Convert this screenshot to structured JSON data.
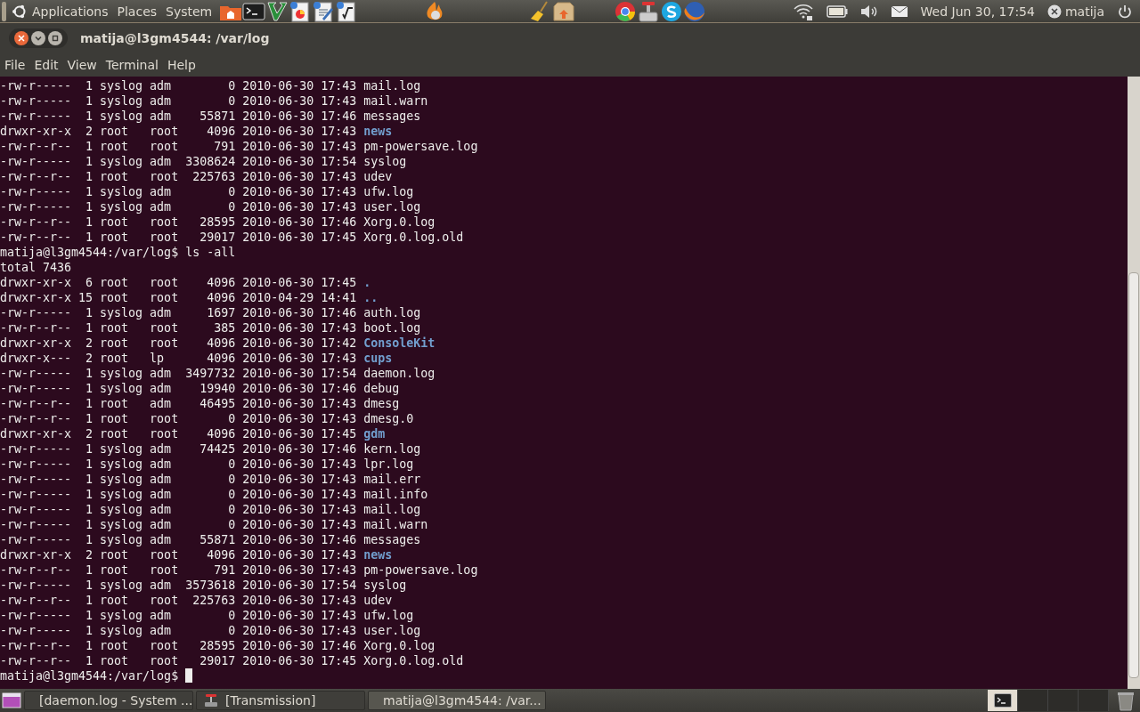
{
  "top_panel": {
    "menus": [
      {
        "label": "Applications"
      },
      {
        "label": "Places"
      },
      {
        "label": "System"
      }
    ],
    "clock": "Wed Jun 30, 17:54",
    "user": "matija"
  },
  "window": {
    "title": "matija@l3gm4544: /var/log",
    "menu": [
      {
        "label": "File"
      },
      {
        "label": "Edit"
      },
      {
        "label": "View"
      },
      {
        "label": "Terminal"
      },
      {
        "label": "Help"
      }
    ]
  },
  "terminal": {
    "lines": [
      {
        "kind": "entry",
        "info": "-rw-r-----  1 syslog adm        0 2010-06-30 17:43",
        "name": "mail.log",
        "directory": false
      },
      {
        "kind": "entry",
        "info": "-rw-r-----  1 syslog adm        0 2010-06-30 17:43",
        "name": "mail.warn",
        "directory": false
      },
      {
        "kind": "entry",
        "info": "-rw-r-----  1 syslog adm    55871 2010-06-30 17:46",
        "name": "messages",
        "directory": false
      },
      {
        "kind": "entry",
        "info": "drwxr-xr-x  2 root   root    4096 2010-06-30 17:43",
        "name": "news",
        "directory": true
      },
      {
        "kind": "entry",
        "info": "-rw-r--r--  1 root   root     791 2010-06-30 17:43",
        "name": "pm-powersave.log",
        "directory": false
      },
      {
        "kind": "entry",
        "info": "-rw-r-----  1 syslog adm  3308624 2010-06-30 17:54",
        "name": "syslog",
        "directory": false
      },
      {
        "kind": "entry",
        "info": "-rw-r--r--  1 root   root  225763 2010-06-30 17:43",
        "name": "udev",
        "directory": false
      },
      {
        "kind": "entry",
        "info": "-rw-r-----  1 syslog adm        0 2010-06-30 17:43",
        "name": "ufw.log",
        "directory": false
      },
      {
        "kind": "entry",
        "info": "-rw-r-----  1 syslog adm        0 2010-06-30 17:43",
        "name": "user.log",
        "directory": false
      },
      {
        "kind": "entry",
        "info": "-rw-r--r--  1 root   root   28595 2010-06-30 17:46",
        "name": "Xorg.0.log",
        "directory": false
      },
      {
        "kind": "entry",
        "info": "-rw-r--r--  1 root   root   29017 2010-06-30 17:45",
        "name": "Xorg.0.log.old",
        "directory": false
      },
      {
        "kind": "prompt",
        "text": "matija@l3gm4544:/var/log$ ls -all",
        "cursor": false
      },
      {
        "kind": "text",
        "text": "total 7436"
      },
      {
        "kind": "entry",
        "info": "drwxr-xr-x  6 root   root    4096 2010-06-30 17:45",
        "name": ".",
        "directory": true
      },
      {
        "kind": "entry",
        "info": "drwxr-xr-x 15 root   root    4096 2010-04-29 14:41",
        "name": "..",
        "directory": true
      },
      {
        "kind": "entry",
        "info": "-rw-r-----  1 syslog adm     1697 2010-06-30 17:46",
        "name": "auth.log",
        "directory": false
      },
      {
        "kind": "entry",
        "info": "-rw-r--r--  1 root   root     385 2010-06-30 17:43",
        "name": "boot.log",
        "directory": false
      },
      {
        "kind": "entry",
        "info": "drwxr-xr-x  2 root   root    4096 2010-06-30 17:42",
        "name": "ConsoleKit",
        "directory": true
      },
      {
        "kind": "entry",
        "info": "drwxr-x---  2 root   lp      4096 2010-06-30 17:43",
        "name": "cups",
        "directory": true
      },
      {
        "kind": "entry",
        "info": "-rw-r-----  1 syslog adm  3497732 2010-06-30 17:54",
        "name": "daemon.log",
        "directory": false
      },
      {
        "kind": "entry",
        "info": "-rw-r-----  1 syslog adm    19940 2010-06-30 17:46",
        "name": "debug",
        "directory": false
      },
      {
        "kind": "entry",
        "info": "-rw-r--r--  1 root   adm    46495 2010-06-30 17:43",
        "name": "dmesg",
        "directory": false
      },
      {
        "kind": "entry",
        "info": "-rw-r--r--  1 root   root       0 2010-06-30 17:43",
        "name": "dmesg.0",
        "directory": false
      },
      {
        "kind": "entry",
        "info": "drwxr-xr-x  2 root   root    4096 2010-06-30 17:45",
        "name": "gdm",
        "directory": true
      },
      {
        "kind": "entry",
        "info": "-rw-r-----  1 syslog adm    74425 2010-06-30 17:46",
        "name": "kern.log",
        "directory": false
      },
      {
        "kind": "entry",
        "info": "-rw-r-----  1 syslog adm        0 2010-06-30 17:43",
        "name": "lpr.log",
        "directory": false
      },
      {
        "kind": "entry",
        "info": "-rw-r-----  1 syslog adm        0 2010-06-30 17:43",
        "name": "mail.err",
        "directory": false
      },
      {
        "kind": "entry",
        "info": "-rw-r-----  1 syslog adm        0 2010-06-30 17:43",
        "name": "mail.info",
        "directory": false
      },
      {
        "kind": "entry",
        "info": "-rw-r-----  1 syslog adm        0 2010-06-30 17:43",
        "name": "mail.log",
        "directory": false
      },
      {
        "kind": "entry",
        "info": "-rw-r-----  1 syslog adm        0 2010-06-30 17:43",
        "name": "mail.warn",
        "directory": false
      },
      {
        "kind": "entry",
        "info": "-rw-r-----  1 syslog adm    55871 2010-06-30 17:46",
        "name": "messages",
        "directory": false
      },
      {
        "kind": "entry",
        "info": "drwxr-xr-x  2 root   root    4096 2010-06-30 17:43",
        "name": "news",
        "directory": true
      },
      {
        "kind": "entry",
        "info": "-rw-r--r--  1 root   root     791 2010-06-30 17:43",
        "name": "pm-powersave.log",
        "directory": false
      },
      {
        "kind": "entry",
        "info": "-rw-r-----  1 syslog adm  3573618 2010-06-30 17:54",
        "name": "syslog",
        "directory": false
      },
      {
        "kind": "entry",
        "info": "-rw-r--r--  1 root   root  225763 2010-06-30 17:43",
        "name": "udev",
        "directory": false
      },
      {
        "kind": "entry",
        "info": "-rw-r-----  1 syslog adm        0 2010-06-30 17:43",
        "name": "ufw.log",
        "directory": false
      },
      {
        "kind": "entry",
        "info": "-rw-r-----  1 syslog adm        0 2010-06-30 17:43",
        "name": "user.log",
        "directory": false
      },
      {
        "kind": "entry",
        "info": "-rw-r--r--  1 root   root   28595 2010-06-30 17:46",
        "name": "Xorg.0.log",
        "directory": false
      },
      {
        "kind": "entry",
        "info": "-rw-r--r--  1 root   root   29017 2010-06-30 17:45",
        "name": "Xorg.0.log.old",
        "directory": false
      },
      {
        "kind": "prompt",
        "text": "matija@l3gm4544:/var/log$",
        "cursor": true
      }
    ]
  },
  "taskbar": {
    "tasks": [
      {
        "kind": "viewer",
        "label": "[daemon.log - System ...",
        "selected": false
      },
      {
        "kind": "transmission",
        "label": "[Transmission]",
        "selected": false
      },
      {
        "kind": "terminal",
        "label": "matija@l3gm4544: /var...",
        "selected": true
      }
    ],
    "workspaces": [
      {
        "selected": true,
        "has_window": true
      },
      {
        "selected": false,
        "has_window": false
      },
      {
        "selected": false,
        "has_window": false
      },
      {
        "selected": false,
        "has_window": false
      }
    ]
  }
}
